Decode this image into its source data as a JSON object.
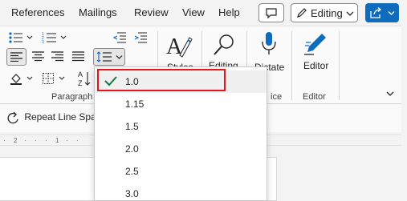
{
  "menubar": {
    "tabs": [
      "References",
      "Mailings",
      "Review",
      "View",
      "Help"
    ],
    "editing_mode_label": "Editing"
  },
  "ribbon": {
    "paragraph_group_label": "Paragraph",
    "styles_label": "Styles",
    "editing_label": "Editing",
    "dictate_label": "Dictate",
    "voice_group_label": "ice",
    "editor_button_label": "Editor",
    "editor_group_label": "Editor"
  },
  "subbar": {
    "repeat_label": "Repeat Line Spac"
  },
  "line_spacing_menu": {
    "options": [
      "1.0",
      "1.15",
      "1.5",
      "2.0",
      "2.5",
      "3.0"
    ],
    "selected": "1.0"
  },
  "colors": {
    "accent": "#0f6cbd",
    "check": "#107c41",
    "highlight_box": "#e5151c"
  },
  "icons": [
    "comment-icon",
    "pencil-icon",
    "chevron-down-icon",
    "share-icon",
    "bullets-icon",
    "numbering-icon",
    "decrease-indent-icon",
    "increase-indent-icon",
    "align-left-icon",
    "align-center-icon",
    "align-right-icon",
    "line-spacing-icon",
    "shading-icon",
    "borders-icon",
    "sort-icon",
    "styles-icon",
    "search-icon",
    "microphone-icon",
    "editor-pen-icon",
    "check-icon",
    "repeat-icon"
  ]
}
